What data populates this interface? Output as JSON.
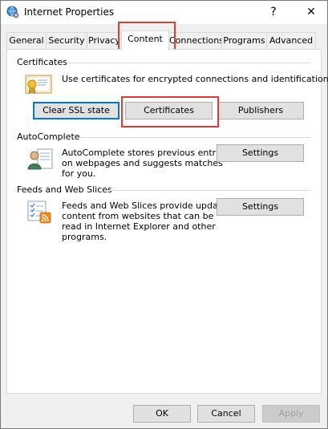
{
  "window": {
    "title": "Internet Properties",
    "help_glyph": "?",
    "close_glyph": "✕"
  },
  "tabs": [
    {
      "label": "General"
    },
    {
      "label": "Security"
    },
    {
      "label": "Privacy"
    },
    {
      "label": "Content"
    },
    {
      "label": "Connections"
    },
    {
      "label": "Programs"
    },
    {
      "label": "Advanced"
    }
  ],
  "active_tab": "Content",
  "certificates": {
    "heading": "Certificates",
    "description": "Use certificates for encrypted connections and identification.",
    "clear_ssl_label": "Clear SSL state",
    "certificates_label": "Certificates",
    "publishers_label": "Publishers"
  },
  "autocomplete": {
    "heading": "AutoComplete",
    "description_lines": [
      "AutoComplete stores previous entries",
      "on webpages and suggests matches",
      "for you."
    ],
    "settings_label": "Settings"
  },
  "feeds": {
    "heading": "Feeds and Web Slices",
    "description_lines": [
      "Feeds and Web Slices provide updated",
      "content from websites that can be",
      "read in Internet Explorer and other",
      "programs."
    ],
    "settings_label": "Settings"
  },
  "footer": {
    "ok_label": "OK",
    "cancel_label": "Cancel",
    "apply_label": "Apply"
  },
  "colors": {
    "highlight": "#e53935",
    "focus": "#0078d7"
  }
}
